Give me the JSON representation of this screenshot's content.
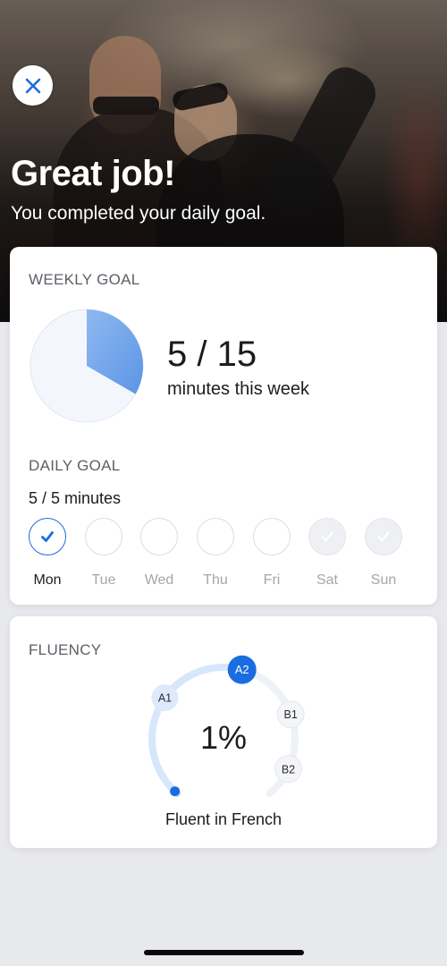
{
  "hero": {
    "title": "Great job!",
    "subtitle": "You completed your daily goal.",
    "close_icon": "close-icon"
  },
  "weekly_goal": {
    "label": "WEEKLY GOAL",
    "completed_minutes": 5,
    "goal_minutes": 15,
    "value_text": "5 / 15",
    "unit_text": "minutes this week",
    "progress_fraction": 0.3333,
    "fill_color": "#6fa3eb",
    "track_color": "#f3f7fd"
  },
  "daily_goal": {
    "label": "DAILY GOAL",
    "value_text": "5 / 5 minutes",
    "days": [
      {
        "label": "Mon",
        "state": "done",
        "today": true
      },
      {
        "label": "Tue",
        "state": "empty",
        "today": false
      },
      {
        "label": "Wed",
        "state": "empty",
        "today": false
      },
      {
        "label": "Thu",
        "state": "empty",
        "today": false
      },
      {
        "label": "Fri",
        "state": "empty",
        "today": false
      },
      {
        "label": "Sat",
        "state": "weekend",
        "today": false
      },
      {
        "label": "Sun",
        "state": "weekend",
        "today": false
      }
    ],
    "accent_color": "#1a6de0"
  },
  "fluency": {
    "label": "FLUENCY",
    "percent_text": "1%",
    "progress_percent": 1,
    "target_text": "Fluent in French",
    "levels": [
      {
        "label": "A1",
        "state": "passed"
      },
      {
        "label": "A2",
        "state": "current"
      },
      {
        "label": "B1",
        "state": "upcoming"
      },
      {
        "label": "B2",
        "state": "upcoming"
      }
    ],
    "accent_color": "#1a6de0",
    "track_passed_color": "#d6e7fb",
    "track_upcoming_color": "#eef1f6"
  }
}
